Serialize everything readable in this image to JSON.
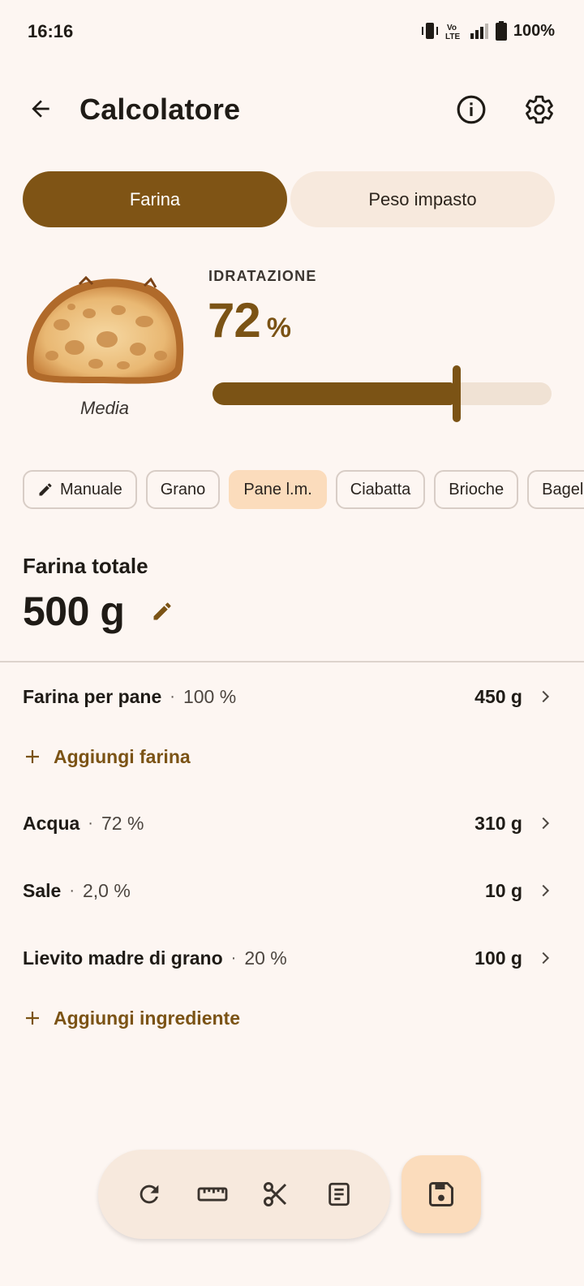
{
  "status_bar": {
    "time": "16:16",
    "battery": "100%"
  },
  "app_bar": {
    "title": "Calcolatore"
  },
  "mode_tabs": [
    {
      "label": "Farina",
      "active": true
    },
    {
      "label": "Peso impasto",
      "active": false
    }
  ],
  "hydration": {
    "caption": "IDRATAZIONE",
    "value": "72",
    "unit": "%",
    "level_label": "Media",
    "slider_fraction": 0.72
  },
  "presets": [
    {
      "label": "Manuale",
      "icon": "pencil-icon",
      "selected": false
    },
    {
      "label": "Grano",
      "selected": false
    },
    {
      "label": "Pane l.m.",
      "selected": true
    },
    {
      "label": "Ciabatta",
      "selected": false
    },
    {
      "label": "Brioche",
      "selected": false
    },
    {
      "label": "Bagel",
      "selected": false
    }
  ],
  "flour_total": {
    "label": "Farina totale",
    "value": "500 g"
  },
  "flours": [
    {
      "name": "Farina per pane",
      "percent": "100 %",
      "amount": "450 g"
    }
  ],
  "add_flour_label": "Aggiungi farina",
  "ingredients": [
    {
      "name": "Acqua",
      "percent": "72 %",
      "amount": "310 g"
    },
    {
      "name": "Sale",
      "percent": "2,0 %",
      "amount": "10 g"
    },
    {
      "name": "Lievito madre di grano",
      "percent": "20 %",
      "amount": "100 g"
    }
  ],
  "add_ingredient_label": "Aggiungi ingrediente",
  "toolbar_icons": [
    "refresh-icon",
    "ruler-icon",
    "scissors-icon",
    "notes-icon"
  ],
  "fab_icon": "save-icon",
  "colors": {
    "primary": "#7b5315",
    "background": "#fdf6f2",
    "tonal": "#f7e9dd",
    "chip_selected": "#fbdcbc"
  }
}
